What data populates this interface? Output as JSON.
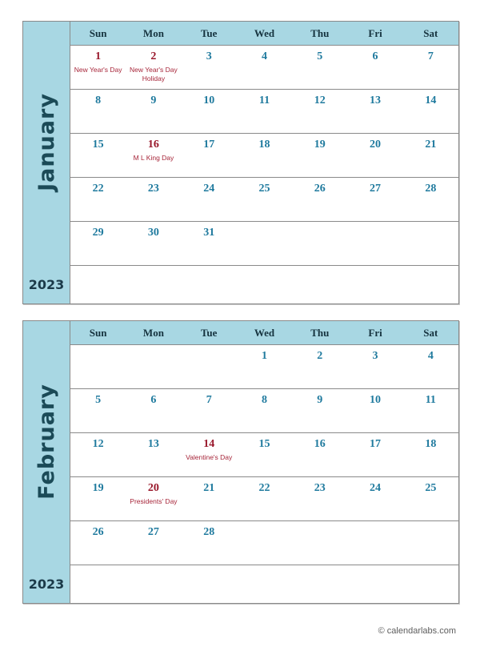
{
  "colors": {
    "header_band": "#a8d7e3",
    "month_label": "#1b4a57",
    "day_number": "#1f7a9e",
    "holiday_number": "#99182b",
    "holiday_text": "#a7263a",
    "border": "#8a8a8a",
    "page_background": "#ffffff"
  },
  "weekdays": [
    "Sun",
    "Mon",
    "Tue",
    "Wed",
    "Thu",
    "Fri",
    "Sat"
  ],
  "footer": {
    "copyright_symbol": "©",
    "text": "calendarlabs.com"
  },
  "months": [
    {
      "name": "January",
      "year": "2023",
      "weeks": [
        [
          {
            "date": "1",
            "holiday": true,
            "event": "New Year's Day"
          },
          {
            "date": "2",
            "holiday": true,
            "event": "New Year's Day Holiday"
          },
          {
            "date": "3",
            "holiday": false,
            "event": ""
          },
          {
            "date": "4",
            "holiday": false,
            "event": ""
          },
          {
            "date": "5",
            "holiday": false,
            "event": ""
          },
          {
            "date": "6",
            "holiday": false,
            "event": ""
          },
          {
            "date": "7",
            "holiday": false,
            "event": ""
          }
        ],
        [
          {
            "date": "8",
            "holiday": false,
            "event": ""
          },
          {
            "date": "9",
            "holiday": false,
            "event": ""
          },
          {
            "date": "10",
            "holiday": false,
            "event": ""
          },
          {
            "date": "11",
            "holiday": false,
            "event": ""
          },
          {
            "date": "12",
            "holiday": false,
            "event": ""
          },
          {
            "date": "13",
            "holiday": false,
            "event": ""
          },
          {
            "date": "14",
            "holiday": false,
            "event": ""
          }
        ],
        [
          {
            "date": "15",
            "holiday": false,
            "event": ""
          },
          {
            "date": "16",
            "holiday": true,
            "event": "M L King Day"
          },
          {
            "date": "17",
            "holiday": false,
            "event": ""
          },
          {
            "date": "18",
            "holiday": false,
            "event": ""
          },
          {
            "date": "19",
            "holiday": false,
            "event": ""
          },
          {
            "date": "20",
            "holiday": false,
            "event": ""
          },
          {
            "date": "21",
            "holiday": false,
            "event": ""
          }
        ],
        [
          {
            "date": "22",
            "holiday": false,
            "event": ""
          },
          {
            "date": "23",
            "holiday": false,
            "event": ""
          },
          {
            "date": "24",
            "holiday": false,
            "event": ""
          },
          {
            "date": "25",
            "holiday": false,
            "event": ""
          },
          {
            "date": "26",
            "holiday": false,
            "event": ""
          },
          {
            "date": "27",
            "holiday": false,
            "event": ""
          },
          {
            "date": "28",
            "holiday": false,
            "event": ""
          }
        ],
        [
          {
            "date": "29",
            "holiday": false,
            "event": ""
          },
          {
            "date": "30",
            "holiday": false,
            "event": ""
          },
          {
            "date": "31",
            "holiday": false,
            "event": ""
          },
          {
            "date": "",
            "holiday": false,
            "event": ""
          },
          {
            "date": "",
            "holiday": false,
            "event": ""
          },
          {
            "date": "",
            "holiday": false,
            "event": ""
          },
          {
            "date": "",
            "holiday": false,
            "event": ""
          }
        ],
        [
          {
            "date": "",
            "holiday": false,
            "event": ""
          },
          {
            "date": "",
            "holiday": false,
            "event": ""
          },
          {
            "date": "",
            "holiday": false,
            "event": ""
          },
          {
            "date": "",
            "holiday": false,
            "event": ""
          },
          {
            "date": "",
            "holiday": false,
            "event": ""
          },
          {
            "date": "",
            "holiday": false,
            "event": ""
          },
          {
            "date": "",
            "holiday": false,
            "event": ""
          }
        ]
      ]
    },
    {
      "name": "February",
      "year": "2023",
      "weeks": [
        [
          {
            "date": "",
            "holiday": false,
            "event": ""
          },
          {
            "date": "",
            "holiday": false,
            "event": ""
          },
          {
            "date": "",
            "holiday": false,
            "event": ""
          },
          {
            "date": "1",
            "holiday": false,
            "event": ""
          },
          {
            "date": "2",
            "holiday": false,
            "event": ""
          },
          {
            "date": "3",
            "holiday": false,
            "event": ""
          },
          {
            "date": "4",
            "holiday": false,
            "event": ""
          }
        ],
        [
          {
            "date": "5",
            "holiday": false,
            "event": ""
          },
          {
            "date": "6",
            "holiday": false,
            "event": ""
          },
          {
            "date": "7",
            "holiday": false,
            "event": ""
          },
          {
            "date": "8",
            "holiday": false,
            "event": ""
          },
          {
            "date": "9",
            "holiday": false,
            "event": ""
          },
          {
            "date": "10",
            "holiday": false,
            "event": ""
          },
          {
            "date": "11",
            "holiday": false,
            "event": ""
          }
        ],
        [
          {
            "date": "12",
            "holiday": false,
            "event": ""
          },
          {
            "date": "13",
            "holiday": false,
            "event": ""
          },
          {
            "date": "14",
            "holiday": true,
            "event": "Valentine's Day"
          },
          {
            "date": "15",
            "holiday": false,
            "event": ""
          },
          {
            "date": "16",
            "holiday": false,
            "event": ""
          },
          {
            "date": "17",
            "holiday": false,
            "event": ""
          },
          {
            "date": "18",
            "holiday": false,
            "event": ""
          }
        ],
        [
          {
            "date": "19",
            "holiday": false,
            "event": ""
          },
          {
            "date": "20",
            "holiday": true,
            "event": "Presidents' Day"
          },
          {
            "date": "21",
            "holiday": false,
            "event": ""
          },
          {
            "date": "22",
            "holiday": false,
            "event": ""
          },
          {
            "date": "23",
            "holiday": false,
            "event": ""
          },
          {
            "date": "24",
            "holiday": false,
            "event": ""
          },
          {
            "date": "25",
            "holiday": false,
            "event": ""
          }
        ],
        [
          {
            "date": "26",
            "holiday": false,
            "event": ""
          },
          {
            "date": "27",
            "holiday": false,
            "event": ""
          },
          {
            "date": "28",
            "holiday": false,
            "event": ""
          },
          {
            "date": "",
            "holiday": false,
            "event": ""
          },
          {
            "date": "",
            "holiday": false,
            "event": ""
          },
          {
            "date": "",
            "holiday": false,
            "event": ""
          },
          {
            "date": "",
            "holiday": false,
            "event": ""
          }
        ],
        [
          {
            "date": "",
            "holiday": false,
            "event": ""
          },
          {
            "date": "",
            "holiday": false,
            "event": ""
          },
          {
            "date": "",
            "holiday": false,
            "event": ""
          },
          {
            "date": "",
            "holiday": false,
            "event": ""
          },
          {
            "date": "",
            "holiday": false,
            "event": ""
          },
          {
            "date": "",
            "holiday": false,
            "event": ""
          },
          {
            "date": "",
            "holiday": false,
            "event": ""
          }
        ]
      ]
    }
  ]
}
